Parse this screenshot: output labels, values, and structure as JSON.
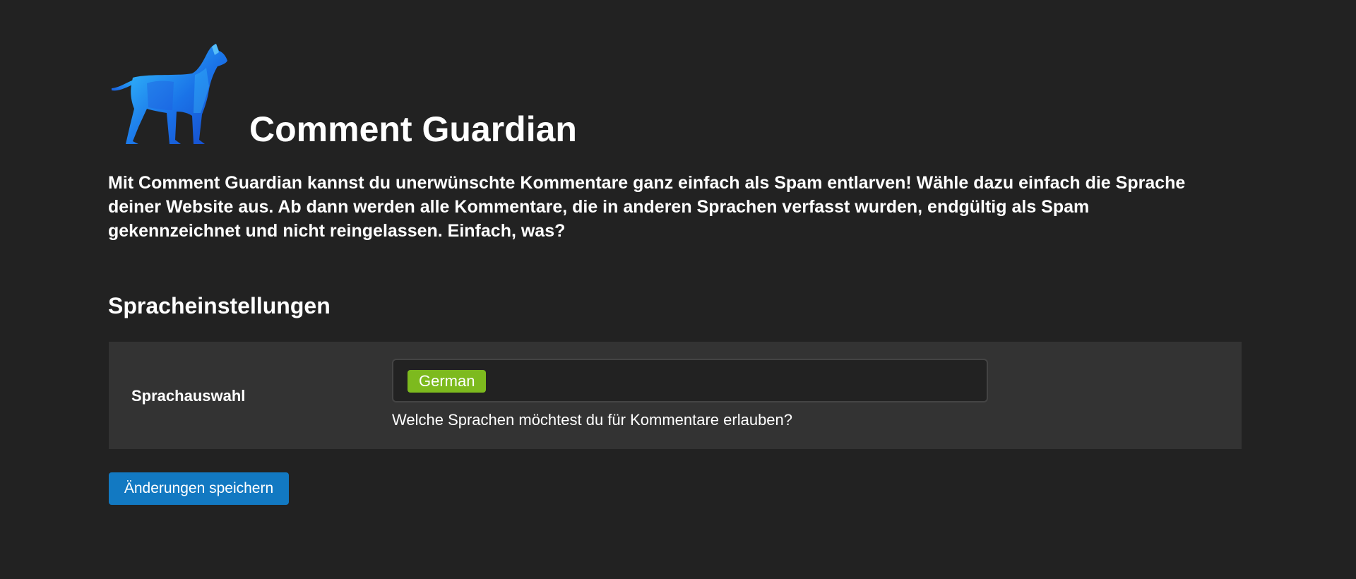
{
  "header": {
    "logo_icon": "dog-logo-icon",
    "title": "Comment Guardian"
  },
  "intro": {
    "text": "Mit Comment Guardian kannst du unerwünschte Kommentare ganz einfach als Spam entlarven! Wähle dazu einfach die Sprache deiner Website aus. Ab dann werden alle Kommentare, die in anderen Sprachen verfasst wurden, endgültig als Spam gekennzeichnet und nicht reingelassen. Einfach, was?"
  },
  "settings": {
    "section_title": "Spracheinstellungen",
    "field_label": "Sprachauswahl",
    "selected_languages": [
      "German"
    ],
    "help_text": "Welche Sprachen möchtest du für Kommentare erlauben?"
  },
  "actions": {
    "save_label": "Änderungen speichern"
  },
  "colors": {
    "background": "#222222",
    "panel": "#333333",
    "tag": "#7dba1e",
    "primary_button": "#1279c2",
    "logo_blue": "#1a73e8"
  }
}
